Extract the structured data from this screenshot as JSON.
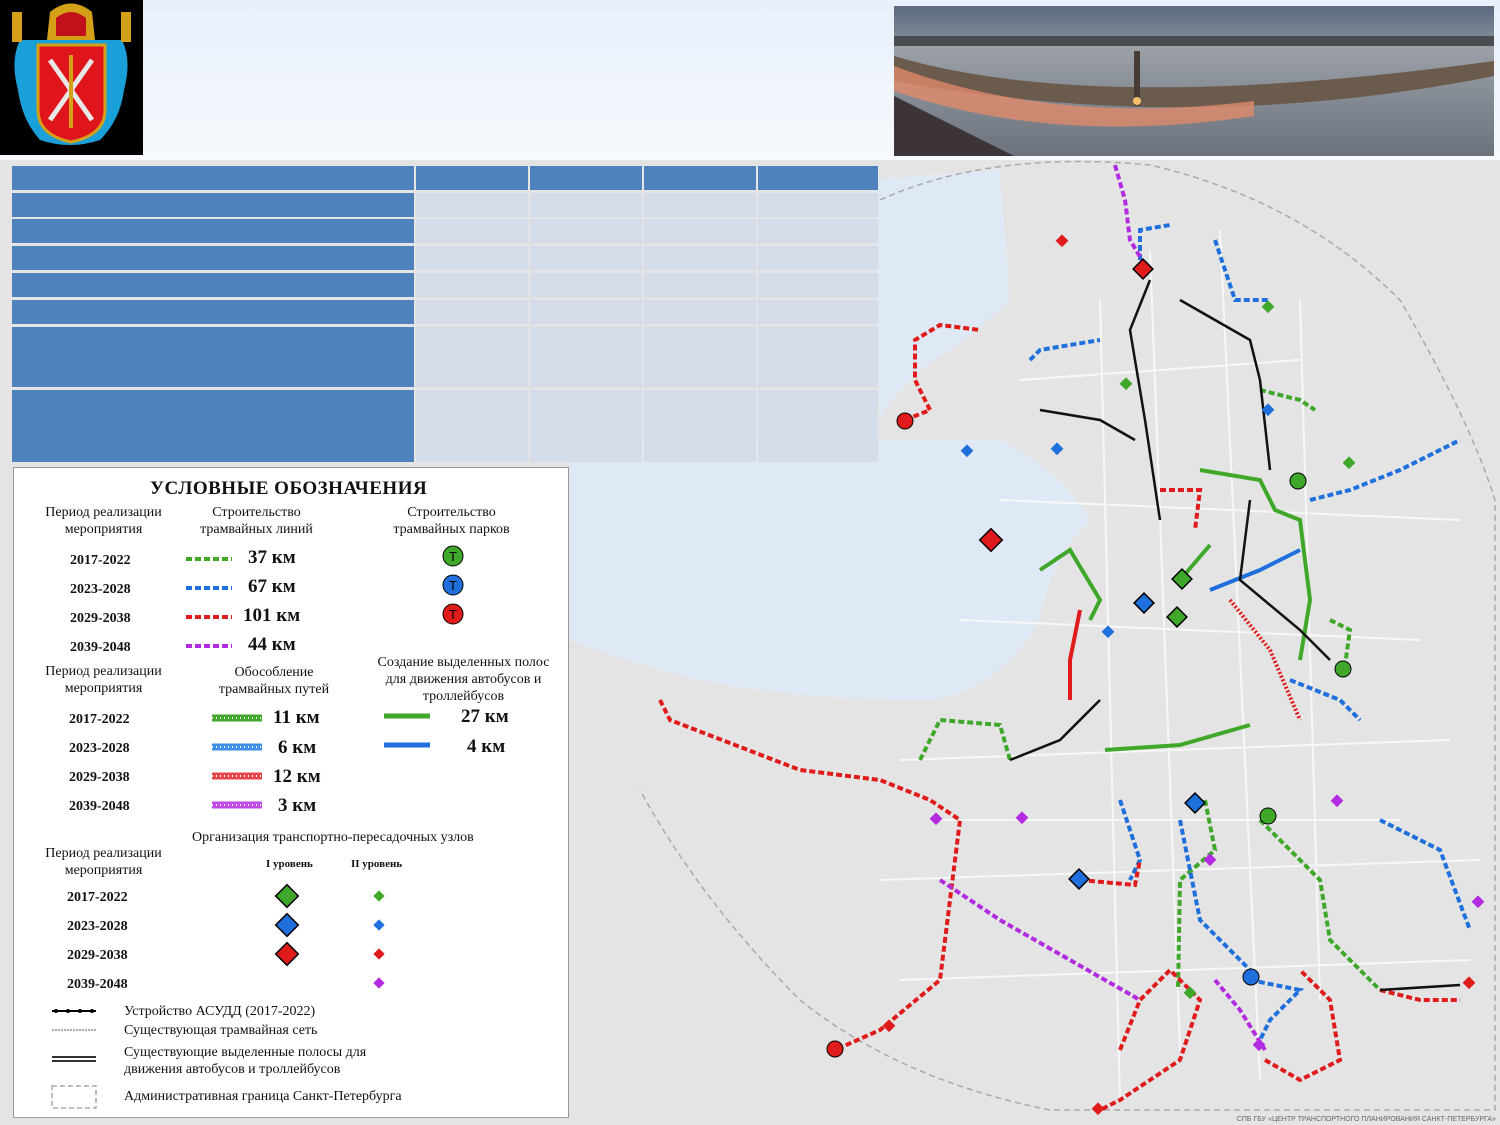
{
  "colors": {
    "p2017": "#3fa82a",
    "p2023": "#1f6fdc",
    "p2029": "#e01b1b",
    "p2039": "#b32be0",
    "header": "#4f81bd",
    "cell": "#d4dbe9",
    "asudd": "#000000"
  },
  "legend": {
    "title": "УСЛОВНЫЕ ОБОЗНАЧЕНИЯ",
    "period_heading": "Период реализации мероприятия",
    "tram_lines_heading": "Строительство трамвайных линий",
    "tram_parks_heading": "Строительство трамвайных парков",
    "isolation_heading": "Обособление трамвайных путей",
    "bus_lanes_heading": "Создание выделенных полос для движения автобусов и троллейбусов",
    "hubs_heading": "Организация транспортно-пересадочных узлов",
    "level1": "I уровень",
    "level2": "II уровень",
    "periods": [
      "2017-2022",
      "2023-2028",
      "2029-2038",
      "2039-2048"
    ],
    "tram_lines_km": [
      "37 км",
      "67 км",
      "101 км",
      "44 км"
    ],
    "isolation_km": [
      "11 км",
      "6 км",
      "12 км",
      "3 км"
    ],
    "bus_lanes_km": [
      "27 км",
      "4 км"
    ],
    "park_icon_letter": "Т",
    "asudd": "Устройство АСУДД (2017-2022)",
    "existing_tram": "Существующая трамвайная сеть",
    "existing_lanes": "Существующие выделенные полосы для движения автобусов и троллейбусов",
    "boundary": "Административная граница Санкт-Петербурга"
  },
  "credit": "СПБ ГБУ «ЦЕНТР ТРАНСПОРТНОГО ПЛАНИРОВАНИЯ САНКТ-ПЕТЕРБУРГА»",
  "images": {
    "crest": "coat-of-arms",
    "photo": "trinity-bridge-night-panorama"
  }
}
